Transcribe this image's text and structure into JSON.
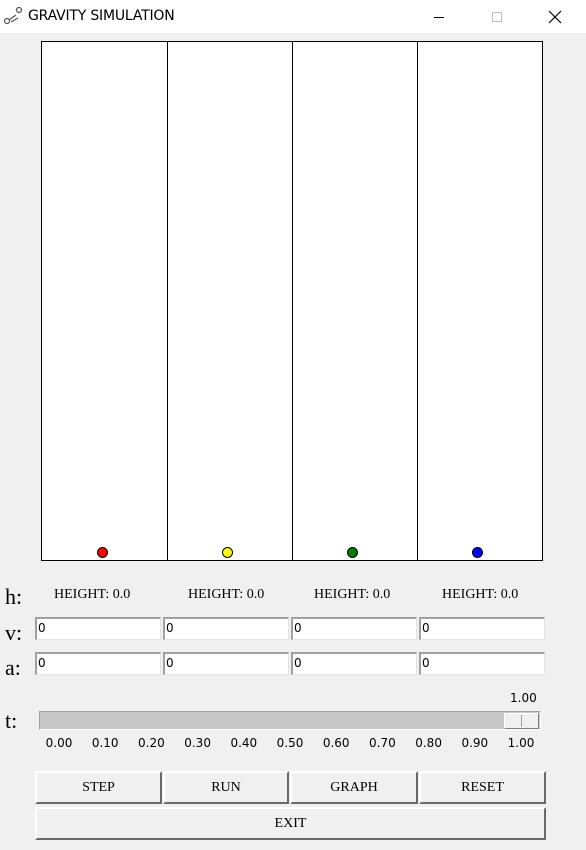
{
  "window": {
    "title": "GRAVITY SIMULATION",
    "icons": {
      "app": "satellite-icon",
      "minimize": "minimize-icon",
      "maximize": "maximize-icon",
      "close": "close-icon"
    }
  },
  "simulation": {
    "balls": [
      {
        "color": "#ff0000"
      },
      {
        "color": "#ffff00"
      },
      {
        "color": "#008000"
      },
      {
        "color": "#0000ff"
      }
    ]
  },
  "labels": {
    "h": "h:",
    "v": "v:",
    "a": "a:",
    "t": "t:"
  },
  "heights": [
    "HEIGHT: 0.0",
    "HEIGHT: 0.0",
    "HEIGHT: 0.0",
    "HEIGHT: 0.0"
  ],
  "velocity": [
    "0",
    "0",
    "0",
    "0"
  ],
  "acceleration": [
    "0",
    "0",
    "0",
    "0"
  ],
  "time_slider": {
    "value": 1.0,
    "value_label": "1.00",
    "min": 0.0,
    "max": 1.0,
    "ticks": [
      "0.00",
      "0.10",
      "0.20",
      "0.30",
      "0.40",
      "0.50",
      "0.60",
      "0.70",
      "0.80",
      "0.90",
      "1.00"
    ]
  },
  "buttons": {
    "step": "STEP",
    "run": "RUN",
    "graph": "GRAPH",
    "reset": "RESET",
    "exit": "EXIT"
  }
}
